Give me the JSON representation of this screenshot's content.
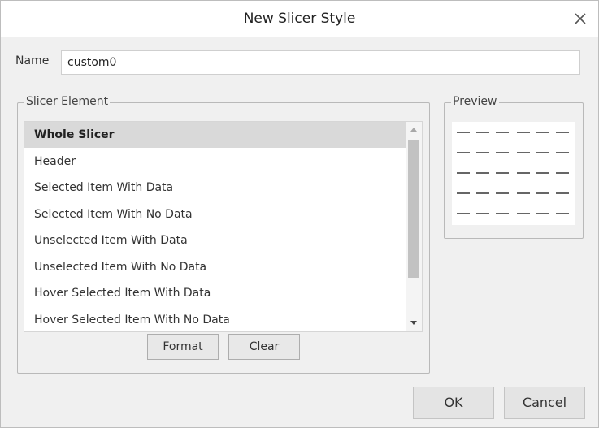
{
  "dialog": {
    "title": "New Slicer Style"
  },
  "name_field": {
    "label": "Name",
    "value": "custom0"
  },
  "slicer_element": {
    "legend": "Slicer Element",
    "items": [
      {
        "label": "Whole Slicer",
        "selected": true
      },
      {
        "label": "Header",
        "selected": false
      },
      {
        "label": "Selected Item With Data",
        "selected": false
      },
      {
        "label": "Selected Item With No Data",
        "selected": false
      },
      {
        "label": "Unselected Item With Data",
        "selected": false
      },
      {
        "label": "Unselected Item With No Data",
        "selected": false
      },
      {
        "label": "Hover Selected Item With Data",
        "selected": false
      },
      {
        "label": "Hover Selected Item With No Data",
        "selected": false
      }
    ],
    "format_label": "Format",
    "clear_label": "Clear"
  },
  "preview": {
    "legend": "Preview"
  },
  "footer": {
    "ok_label": "OK",
    "cancel_label": "Cancel"
  },
  "colors": {
    "selected_row": "#d9d9d9",
    "dialog_bg": "#f0f0f0",
    "preview_dash": "#333333"
  },
  "icons": {
    "close": "close-icon",
    "scroll_up": "triangle-up-icon",
    "scroll_down": "triangle-down-icon"
  }
}
